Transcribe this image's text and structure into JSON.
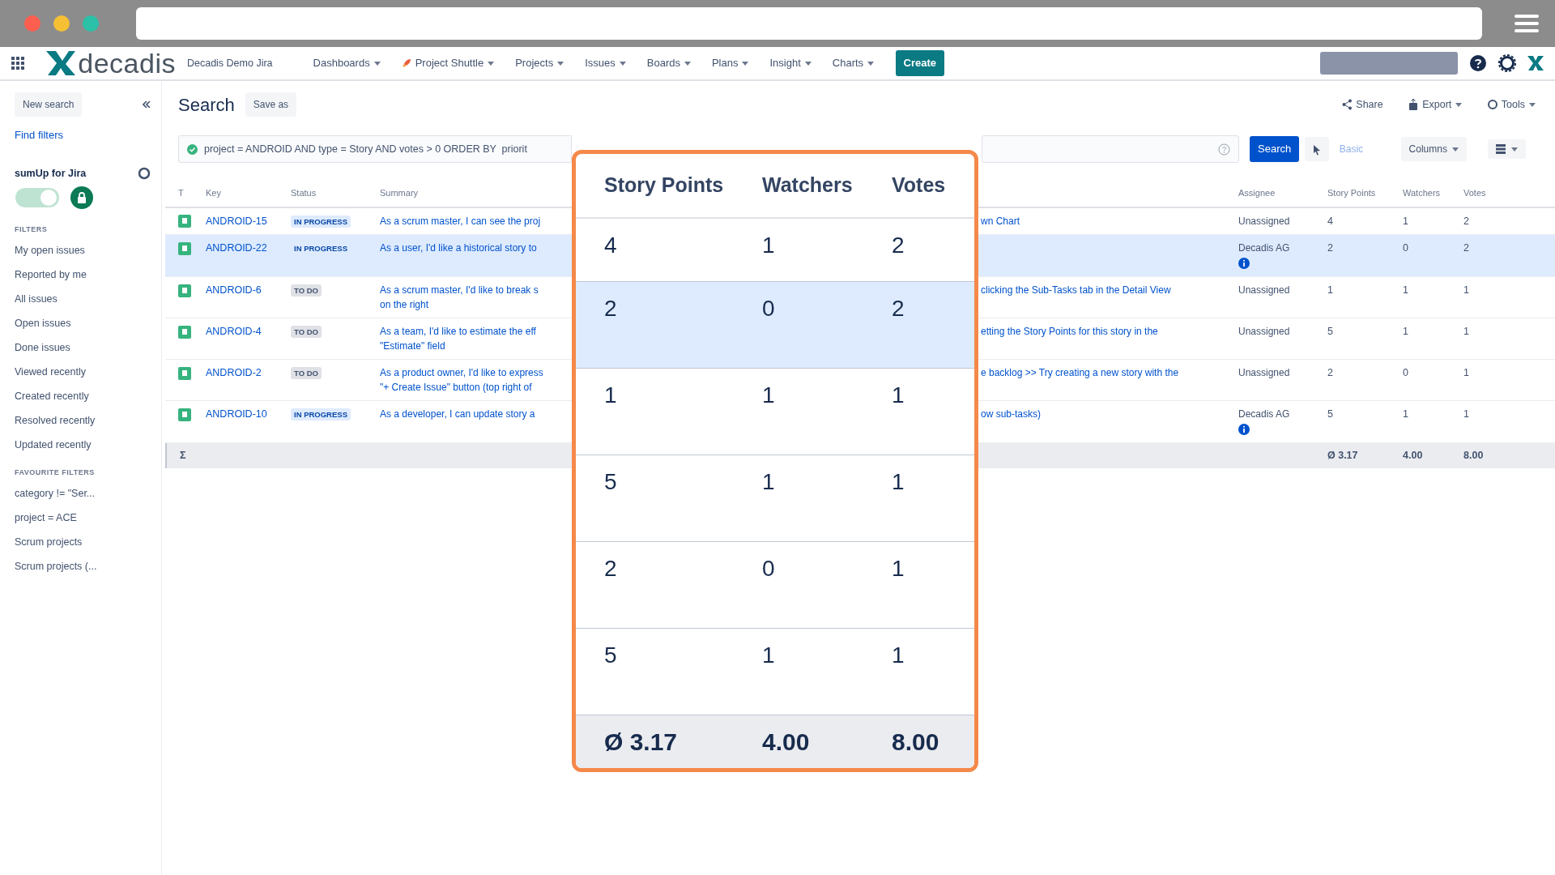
{
  "nav": {
    "logo": "decadis",
    "product": "Decadis Demo Jira",
    "menus": [
      {
        "label": "Dashboards"
      },
      {
        "label": "Project Shuttle"
      },
      {
        "label": "Projects"
      },
      {
        "label": "Issues"
      },
      {
        "label": "Boards"
      },
      {
        "label": "Plans"
      },
      {
        "label": "Insight"
      },
      {
        "label": "Charts"
      }
    ],
    "create": "Create"
  },
  "sidebar": {
    "new_search": "New search",
    "find_filters": "Find filters",
    "app_title": "sumUp for Jira",
    "app_on": true,
    "filters_heading": "FILTERS",
    "filters": [
      "My open issues",
      "Reported by me",
      "All issues",
      "Open issues",
      "Done issues",
      "Viewed recently",
      "Created recently",
      "Resolved recently",
      "Updated recently"
    ],
    "favourites_heading": "FAVOURITE FILTERS",
    "favourites": [
      "category != \"Ser...",
      "project = ACE",
      "Scrum projects",
      "Scrum projects (..."
    ]
  },
  "header": {
    "title": "Search",
    "save_as": "Save as",
    "actions": [
      {
        "label": "Share"
      },
      {
        "label": "Export"
      },
      {
        "label": "Tools"
      }
    ]
  },
  "jql": {
    "query": "project = ANDROID AND type = Story AND votes > 0 ORDER BY  priorit",
    "search": "Search",
    "basic": "Basic",
    "columns": "Columns"
  },
  "table": {
    "columns": [
      "T",
      "Key",
      "Status",
      "Summary",
      "Assignee",
      "Story Points",
      "Watchers",
      "Votes"
    ],
    "rows": [
      {
        "key": "ANDROID-15",
        "status": "IN PROGRESS",
        "kind": "progress",
        "summary_start": [
          "As a scrum master, I can see the proj"
        ],
        "summary_end": [
          "wn Chart"
        ],
        "assignee": "Unassigned",
        "assignee_info": false,
        "story_points": "4",
        "watchers": "1",
        "votes": "2",
        "selected": false
      },
      {
        "key": "ANDROID-22",
        "status": "IN PROGRESS",
        "kind": "progress",
        "summary_start": [
          "As a user, I'd like a historical story to"
        ],
        "summary_end": [],
        "assignee": "Decadis AG",
        "assignee_info": true,
        "story_points": "2",
        "watchers": "0",
        "votes": "2",
        "selected": true
      },
      {
        "key": "ANDROID-6",
        "status": "TO DO",
        "kind": "todo",
        "summary_start": [
          "As a scrum master, I'd like to break s",
          "on the right"
        ],
        "summary_end": [
          "clicking the Sub-Tasks tab in the Detail View"
        ],
        "assignee": "Unassigned",
        "assignee_info": false,
        "story_points": "1",
        "watchers": "1",
        "votes": "1",
        "selected": false
      },
      {
        "key": "ANDROID-4",
        "status": "TO DO",
        "kind": "todo",
        "summary_start": [
          "As a team, I'd like to estimate the eff",
          "\"Estimate\" field"
        ],
        "summary_end": [
          "etting the Story Points for this story in the"
        ],
        "assignee": "Unassigned",
        "assignee_info": false,
        "story_points": "5",
        "watchers": "1",
        "votes": "1",
        "selected": false
      },
      {
        "key": "ANDROID-2",
        "status": "TO DO",
        "kind": "todo",
        "summary_start": [
          "As a product owner, I'd like to express",
          "\"+ Create Issue\" button (top right of"
        ],
        "summary_end": [
          "e backlog >> Try creating a new story with the"
        ],
        "assignee": "Unassigned",
        "assignee_info": false,
        "story_points": "2",
        "watchers": "0",
        "votes": "1",
        "selected": false
      },
      {
        "key": "ANDROID-10",
        "status": "IN PROGRESS",
        "kind": "progress",
        "summary_start": [
          "As a developer, I can update story a"
        ],
        "summary_end": [
          "ow sub-tasks)"
        ],
        "assignee": "Decadis AG",
        "assignee_info": true,
        "story_points": "5",
        "watchers": "1",
        "votes": "1",
        "selected": false
      }
    ],
    "totals": {
      "symbol": "Σ",
      "story_points": "Ø 3.17",
      "watchers": "4.00",
      "votes": "8.00"
    }
  },
  "callout": {
    "columns": [
      "Story Points",
      "Watchers",
      "Votes"
    ],
    "rows": [
      {
        "story_points": "4",
        "watchers": "1",
        "votes": "2",
        "selected": false
      },
      {
        "story_points": "2",
        "watchers": "0",
        "votes": "2",
        "selected": true
      },
      {
        "story_points": "1",
        "watchers": "1",
        "votes": "1",
        "selected": false
      },
      {
        "story_points": "5",
        "watchers": "1",
        "votes": "1",
        "selected": false
      },
      {
        "story_points": "2",
        "watchers": "0",
        "votes": "1",
        "selected": false
      },
      {
        "story_points": "5",
        "watchers": "1",
        "votes": "1",
        "selected": false
      }
    ],
    "totals": {
      "story_points": "Ø 3.17",
      "watchers": "4.00",
      "votes": "8.00"
    }
  }
}
